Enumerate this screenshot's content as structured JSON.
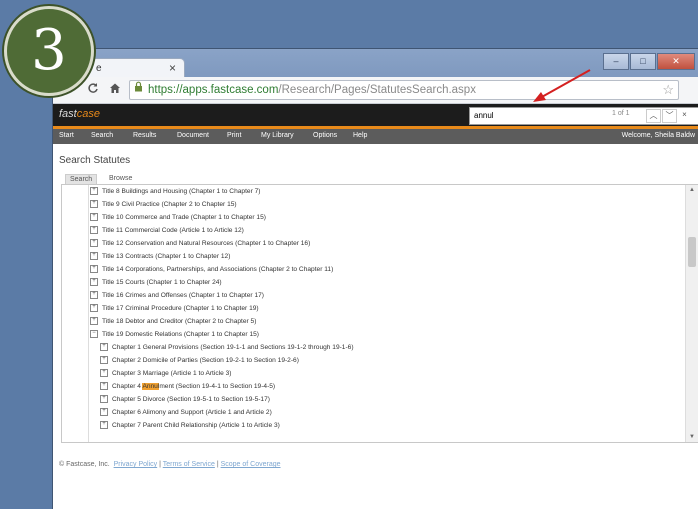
{
  "step_badge": "3",
  "browser": {
    "tab_title": "e",
    "tab_close": "×",
    "window_controls": [
      "–",
      "□",
      "✕"
    ],
    "url_scheme": "https://",
    "url_host": "apps.fastcase.com",
    "url_path": "/Research/Pages/StatutesSearch.aspx",
    "icons": {
      "back": "arrow-left",
      "reload": "reload",
      "home": "home",
      "lock": "lock",
      "star": "star"
    }
  },
  "app": {
    "logo_prefix": "fast",
    "logo_suffix": "case",
    "find": {
      "value": "annul",
      "count": "1 of 1"
    },
    "menu": [
      "Start",
      "Search",
      "Results",
      "Document",
      "Print",
      "My Library",
      "Options",
      "Help"
    ],
    "welcome": "Welcome, Sheila Baldw",
    "accent": "#e88a1a"
  },
  "page": {
    "title": "Search Statutes",
    "tabs": [
      "Search",
      "Browse"
    ],
    "tree": [
      {
        "text": "Title 8 Buildings and Housing (Chapter 1 to Chapter 7)",
        "level": 0
      },
      {
        "text": "Title 9 Civil Practice (Chapter 2 to Chapter 15)",
        "level": 0
      },
      {
        "text": "Title 10 Commerce and Trade (Chapter 1 to Chapter 15)",
        "level": 0
      },
      {
        "text": "Title 11 Commercial Code (Article 1 to Article 12)",
        "level": 0
      },
      {
        "text": "Title 12 Conservation and Natural Resources (Chapter 1 to Chapter 16)",
        "level": 0
      },
      {
        "text": "Title 13 Contracts (Chapter 1 to Chapter 12)",
        "level": 0
      },
      {
        "text": "Title 14 Corporations, Partnerships, and Associations (Chapter 2 to Chapter 11)",
        "level": 0
      },
      {
        "text": "Title 15 Courts (Chapter 1 to Chapter 24)",
        "level": 0
      },
      {
        "text": "Title 16 Crimes and Offenses (Chapter 1 to Chapter 17)",
        "level": 0
      },
      {
        "text": "Title 17 Criminal Procedure (Chapter 1 to Chapter 19)",
        "level": 0
      },
      {
        "text": "Title 18 Debtor and Creditor (Chapter 2 to Chapter 5)",
        "level": 0
      },
      {
        "text": "Title 19 Domestic Relations (Chapter 1 to Chapter 15)",
        "level": 0,
        "expanded": true
      },
      {
        "text": "Chapter 1 General Provisions (Section 19-1-1 and Sections 19-1-2 through 19-1-6)",
        "level": 1
      },
      {
        "text": "Chapter 2 Domicile of Parties (Section 19-2-1 to Section 19-2-6)",
        "level": 1
      },
      {
        "text": "Chapter 3 Marriage (Article 1 to Article 3)",
        "level": 1
      },
      {
        "text_before": "Chapter 4 ",
        "highlight": "Annul",
        "text_after": "ment (Section 19-4-1 to Section 19-4-5)",
        "level": 1
      },
      {
        "text": "Chapter 5 Divorce (Section 19-5-1 to Section 19-5-17)",
        "level": 1
      },
      {
        "text": "Chapter 6 Alimony and Support (Article 1 and Article 2)",
        "level": 1
      },
      {
        "text": "Chapter 7 Parent Child Relationship (Article 1 to Article 3)",
        "level": 1
      }
    ],
    "footer": {
      "copyright": "©  Fastcase, Inc.",
      "links": [
        "Privacy Policy",
        "Terms of Service",
        "Scope of Coverage"
      ]
    }
  }
}
